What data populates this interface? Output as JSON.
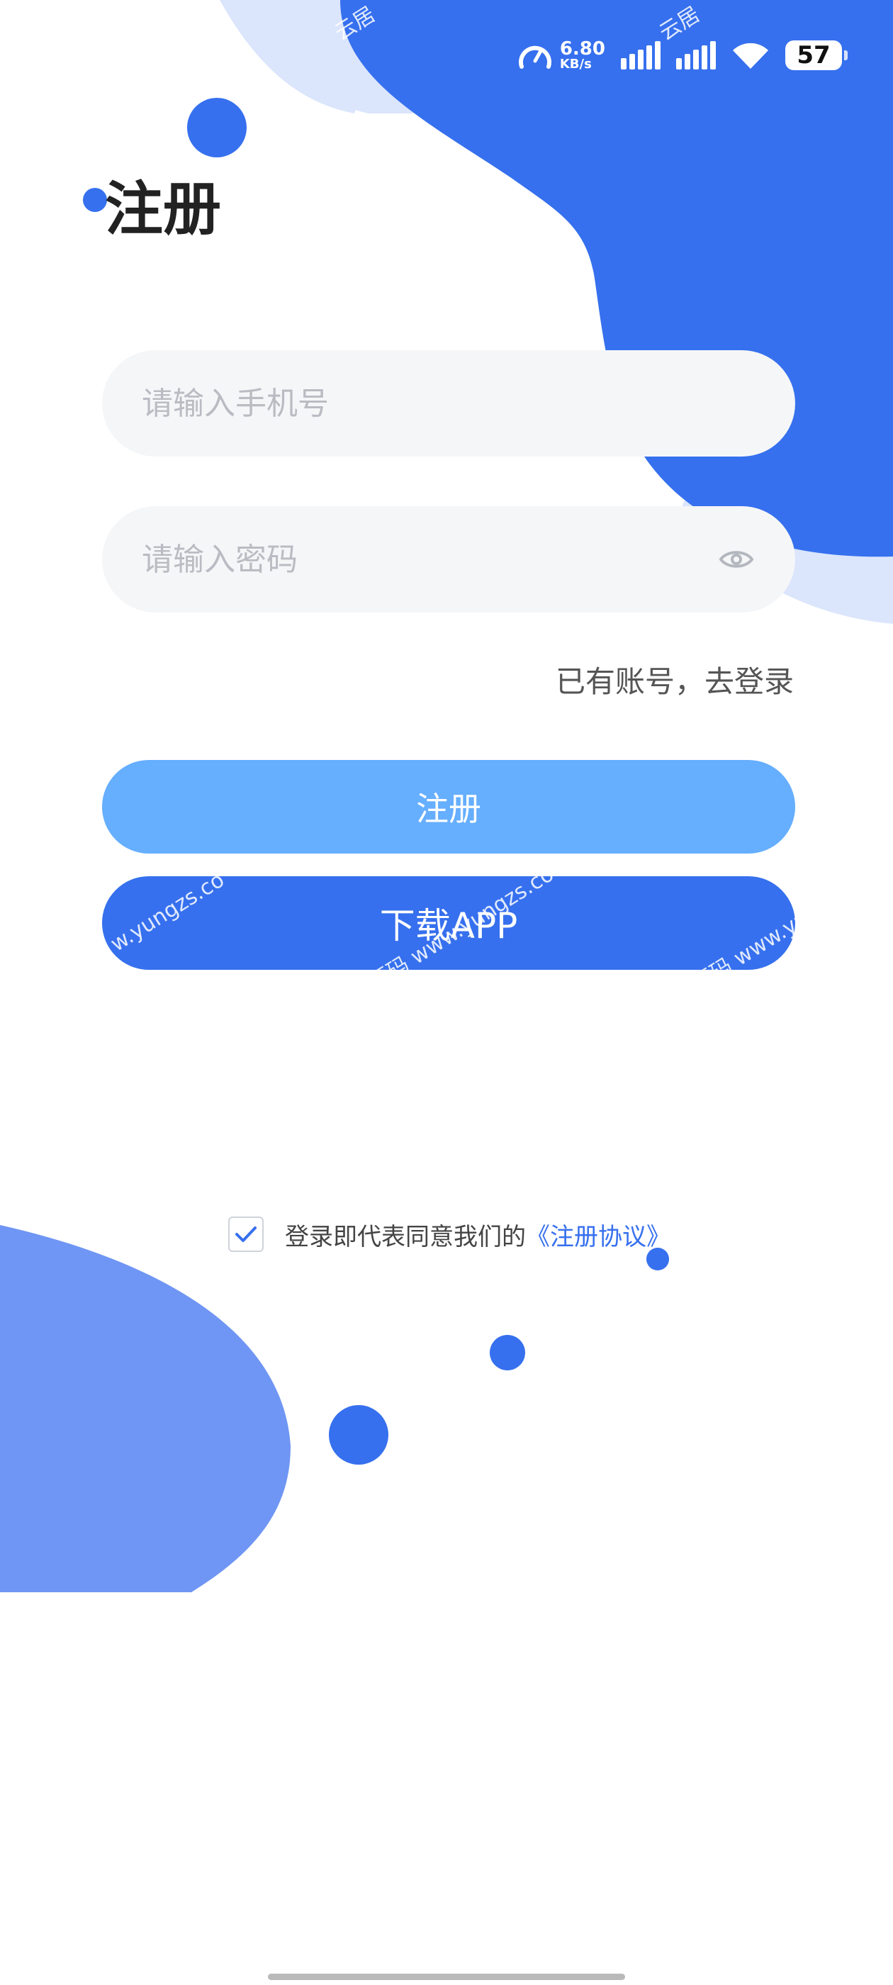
{
  "status_bar": {
    "net_speed_value": "6.80",
    "net_speed_unit": "KB/s",
    "battery_level": "57",
    "icons": [
      "speed-gauge-icon",
      "signal-icon",
      "signal-icon",
      "wifi-icon",
      "battery-icon"
    ]
  },
  "page": {
    "title": "注册"
  },
  "form": {
    "phone_placeholder": "请输入手机号",
    "password_placeholder": "请输入密码",
    "login_link": "已有账号，去登录"
  },
  "buttons": {
    "register_label": "注册",
    "download_label": "下载APP"
  },
  "agreement": {
    "checked": true,
    "text": "登录即代表同意我们的",
    "link_text": "《注册协议》"
  },
  "watermarks": {
    "wm_a": "云居",
    "wm_b": "云居",
    "wm_c": "w.yungzs.co",
    "wm_d": "源码 www.yungzs.co",
    "wm_e": "源码 www.yun"
  },
  "colors": {
    "primary": "#3670ee",
    "primary_light": "#66aefe",
    "blob_light": "#dbe5fc",
    "blob_bottom": "#6f96f4",
    "input_bg": "#f5f6f8"
  }
}
